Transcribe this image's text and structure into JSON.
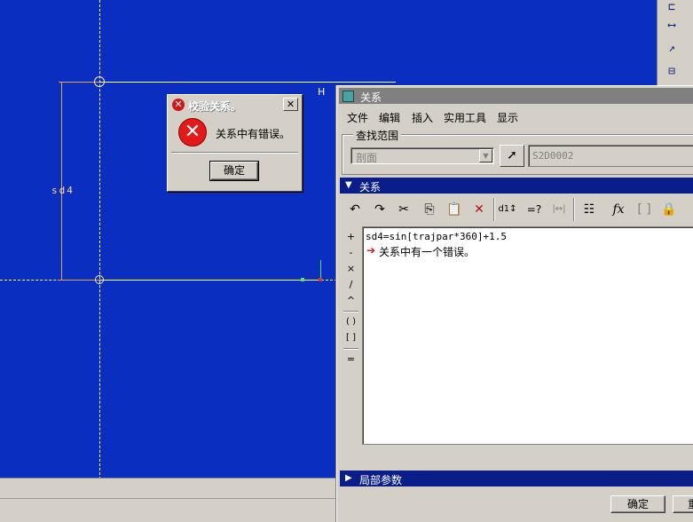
{
  "canvas": {
    "dimension_label": "sd4",
    "horizontal_label": "H",
    "colors": {
      "background": "#0a2fc0",
      "dimension": "#e8a24a",
      "line": "#ffffd8"
    }
  },
  "error_dialog": {
    "title": "校验关系。",
    "close_glyph": "✕",
    "icon_glyph": "✕",
    "message": "关系中有错误。",
    "ok_label": "确定"
  },
  "relations_window": {
    "title": "关系",
    "menu": [
      "文件",
      "编辑",
      "插入",
      "实用工具",
      "显示"
    ],
    "search": {
      "legend": "查找范围",
      "scope_value": "剖面",
      "reference_value": "S2D0002"
    },
    "relations_section": "关系",
    "toolbar": {
      "undo": "↶",
      "redo": "↷",
      "cut": "✂",
      "copy": "⎘",
      "paste": "📋",
      "delete": "✕",
      "sort": "d1↕",
      "evaluate": "=?",
      "measure": "|↔|",
      "params": "☷",
      "function": "fx",
      "brackets": "[ ]",
      "verify": "🔒"
    },
    "operators": [
      "+",
      "-",
      "×",
      "/",
      "^",
      "( )",
      "[ ]",
      "="
    ],
    "editor": {
      "line1": "sd4=sin[trajpar*360]+1.5",
      "error_glyph": "➔",
      "line2": "关系中有一个错误。"
    },
    "local_params_section": "局部参数",
    "ok_label": "确定",
    "second_button_partial": "重"
  },
  "right_toolbar": {
    "icons": [
      "⊏",
      "⟷",
      "↗",
      "⊟"
    ]
  }
}
